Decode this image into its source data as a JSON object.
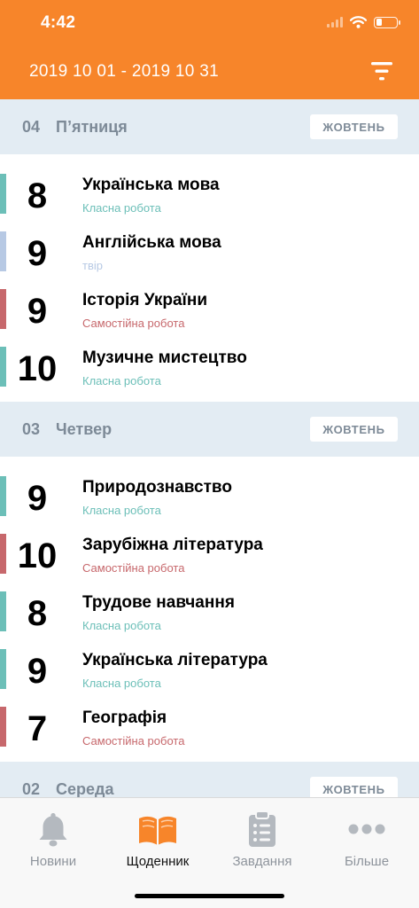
{
  "status_bar": {
    "time": "4:42",
    "battery_level": 0.3
  },
  "header": {
    "date_range": "2019 10 01 - 2019 10 31",
    "filter_icon": "filter-icon",
    "background_color": "#F7852A"
  },
  "work_type_colors": {
    "class": "#6CBFB8",
    "essay": "#B7C9E4",
    "independent": "#C7686C"
  },
  "days": [
    {
      "day_num": "04",
      "day_name": "П’ятниця",
      "month_label": "ЖОВТЕНЬ",
      "grades": [
        {
          "grade": "8",
          "subject": "Українська мова",
          "work_type": "Класна робота",
          "color": "#6CBFB8"
        },
        {
          "grade": "9",
          "subject": "Англійська мова",
          "work_type": "твір",
          "color": "#B7C9E4"
        },
        {
          "grade": "9",
          "subject": "Історія України",
          "work_type": "Самостійна робота",
          "color": "#C7686C"
        },
        {
          "grade": "10",
          "subject": "Музичне мистецтво",
          "work_type": "Класна робота",
          "color": "#6CBFB8"
        }
      ]
    },
    {
      "day_num": "03",
      "day_name": "Четвер",
      "month_label": "ЖОВТЕНЬ",
      "grades": [
        {
          "grade": "9",
          "subject": "Природознавство",
          "work_type": "Класна робота",
          "color": "#6CBFB8"
        },
        {
          "grade": "10",
          "subject": "Зарубіжна література",
          "work_type": "Самостійна робота",
          "color": "#C7686C"
        },
        {
          "grade": "8",
          "subject": "Трудове навчання",
          "work_type": "Класна робота",
          "color": "#6CBFB8"
        },
        {
          "grade": "9",
          "subject": "Українська література",
          "work_type": "Класна робота",
          "color": "#6CBFB8"
        },
        {
          "grade": "7",
          "subject": "Географія",
          "work_type": "Самостійна робота",
          "color": "#C7686C"
        }
      ]
    },
    {
      "day_num": "02",
      "day_name": "Середа",
      "month_label": "ЖОВТЕНЬ",
      "grades": []
    }
  ],
  "tabs": [
    {
      "label": "Новини",
      "icon": "bell-icon",
      "active": false
    },
    {
      "label": "Щоденник",
      "icon": "book-icon",
      "active": true
    },
    {
      "label": "Завдання",
      "icon": "clipboard-icon",
      "active": false
    },
    {
      "label": "Більше",
      "icon": "more-icon",
      "active": false
    }
  ]
}
